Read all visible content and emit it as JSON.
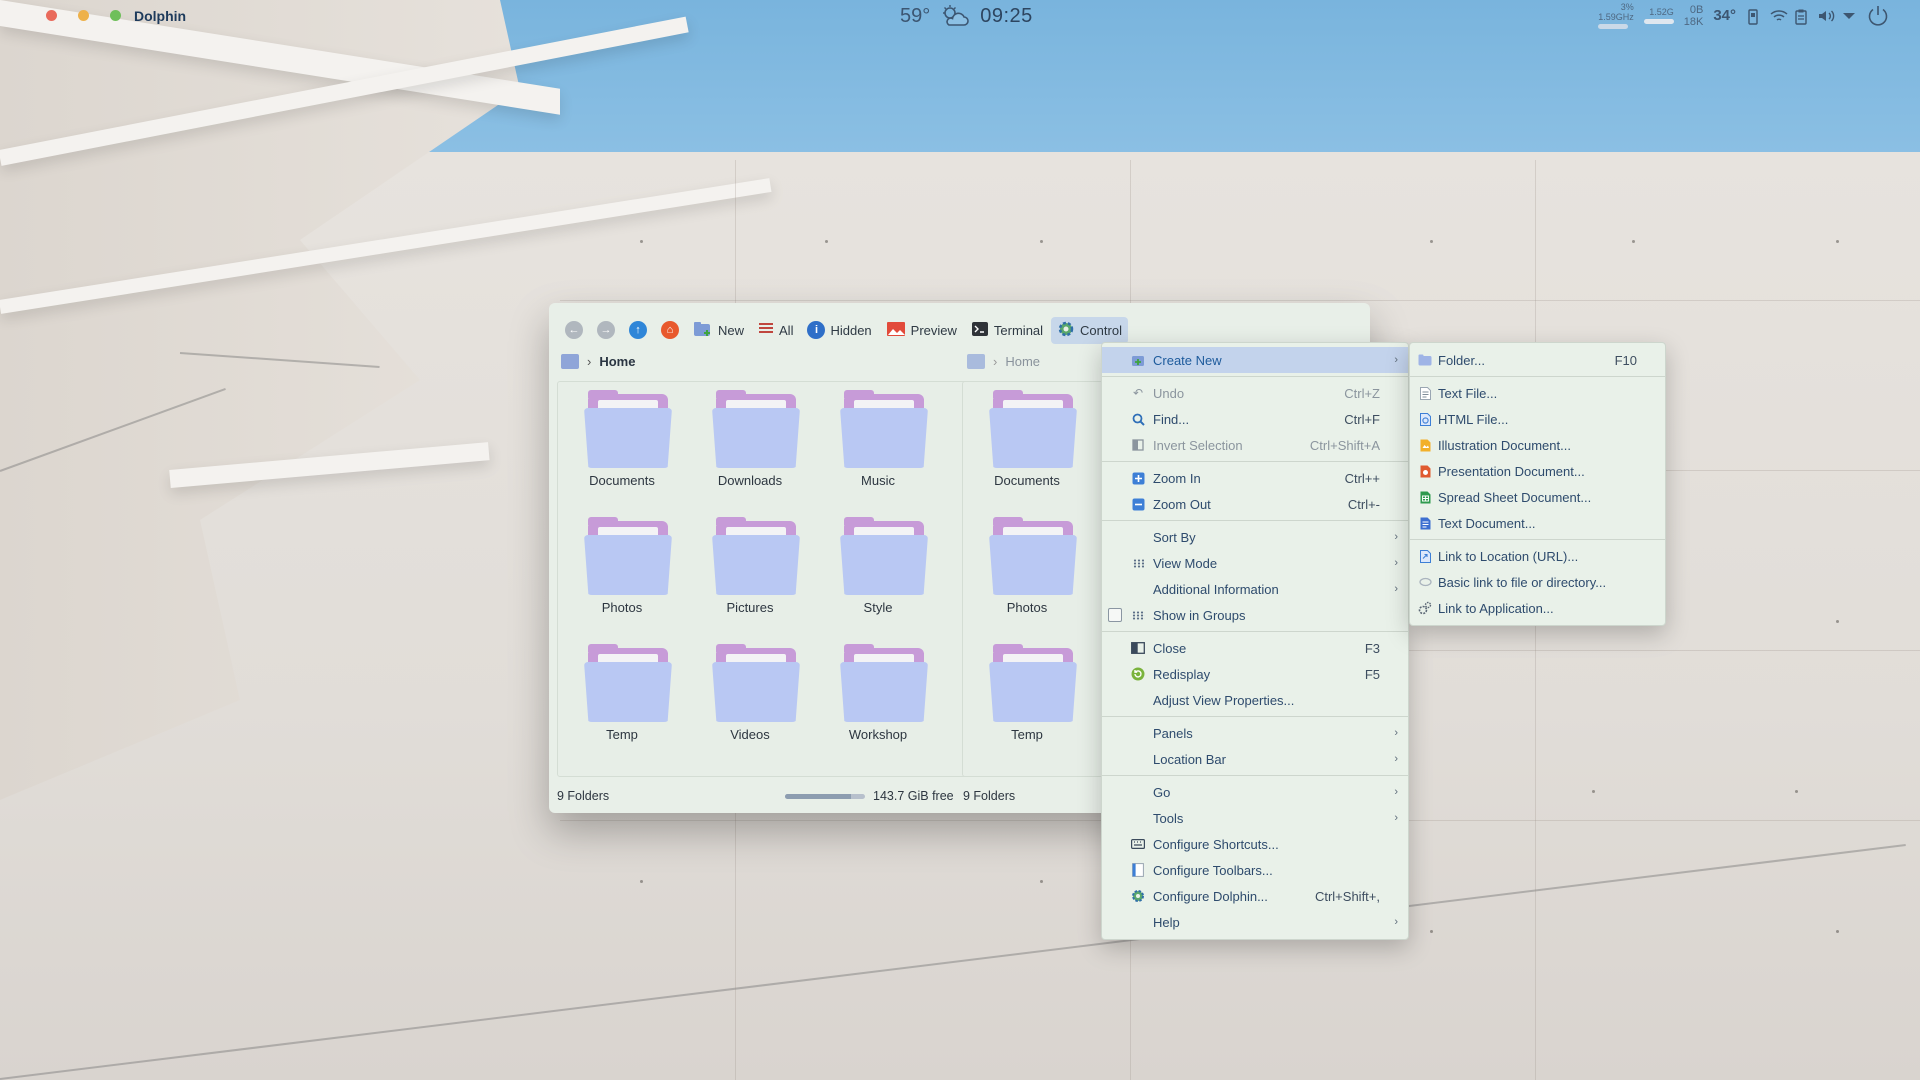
{
  "app": {
    "title": "Dolphin"
  },
  "topbar": {
    "temperature": "59°",
    "time": "09:25",
    "net": {
      "up_rate": "3%",
      "up_freq": "1.59GHz",
      "down_top": "1.52G",
      "mem": "0B",
      "mem2": "18K"
    },
    "cpu_temp": "34°"
  },
  "toolbar": {
    "new_label": "New",
    "all_label": "All",
    "hidden_label": "Hidden",
    "preview_label": "Preview",
    "terminal_label": "Terminal",
    "control_label": "Control"
  },
  "left_pane": {
    "breadcrumb": "Home",
    "folders": [
      "Documents",
      "Downloads",
      "Music",
      "Photos",
      "Pictures",
      "Style",
      "Temp",
      "Videos",
      "Workshop"
    ],
    "status": "9 Folders",
    "free_space": "143.7 GiB free",
    "free_fraction": 0.82
  },
  "right_pane": {
    "breadcrumb": "Home",
    "folders": [
      "Documents",
      "Photos",
      "Temp"
    ],
    "status": "9 Folders"
  },
  "control_menu": {
    "create_new": "Create New",
    "undo": "Undo",
    "undo_shortcut": "Ctrl+Z",
    "find": "Find...",
    "find_shortcut": "Ctrl+F",
    "invert_selection": "Invert Selection",
    "invert_shortcut": "Ctrl+Shift+A",
    "zoom_in": "Zoom In",
    "zoom_in_shortcut": "Ctrl++",
    "zoom_out": "Zoom Out",
    "zoom_out_shortcut": "Ctrl+-",
    "sort_by": "Sort By",
    "view_mode": "View Mode",
    "additional_information": "Additional Information",
    "show_in_groups": "Show in Groups",
    "close": "Close",
    "close_shortcut": "F3",
    "redisplay": "Redisplay",
    "redisplay_shortcut": "F5",
    "adjust_view_properties": "Adjust View Properties...",
    "panels": "Panels",
    "location_bar": "Location Bar",
    "go": "Go",
    "tools": "Tools",
    "configure_shortcuts": "Configure Shortcuts...",
    "configure_toolbars": "Configure Toolbars...",
    "configure_dolphin": "Configure Dolphin...",
    "configure_dolphin_shortcut": "Ctrl+Shift+,",
    "help": "Help"
  },
  "create_new_menu": {
    "folder": "Folder...",
    "folder_shortcut": "F10",
    "text_file": "Text File...",
    "html_file": "HTML File...",
    "illustration_document": "Illustration Document...",
    "presentation_document": "Presentation Document...",
    "spreadsheet_document": "Spread Sheet Document...",
    "text_document": "Text Document...",
    "link_to_location": "Link to Location (URL)...",
    "basic_link": "Basic link to file or directory...",
    "link_to_application": "Link to Application..."
  },
  "colors": {
    "accent": "#3d8be0",
    "menu_bg": "#e9f1e9",
    "highlight": "#c3d3ec",
    "folder_front": "#b9c8f3",
    "folder_back": "#c79bd8",
    "sky": "#7fb7df"
  },
  "icons": {
    "back": "arrow-left-icon",
    "forward": "arrow-right-icon",
    "up": "arrow-up-icon",
    "home": "home-icon",
    "new": "new-folder-icon",
    "all": "list-icon",
    "hidden": "info-icon",
    "preview": "image-icon",
    "terminal": "terminal-icon",
    "control": "gear-icon"
  }
}
